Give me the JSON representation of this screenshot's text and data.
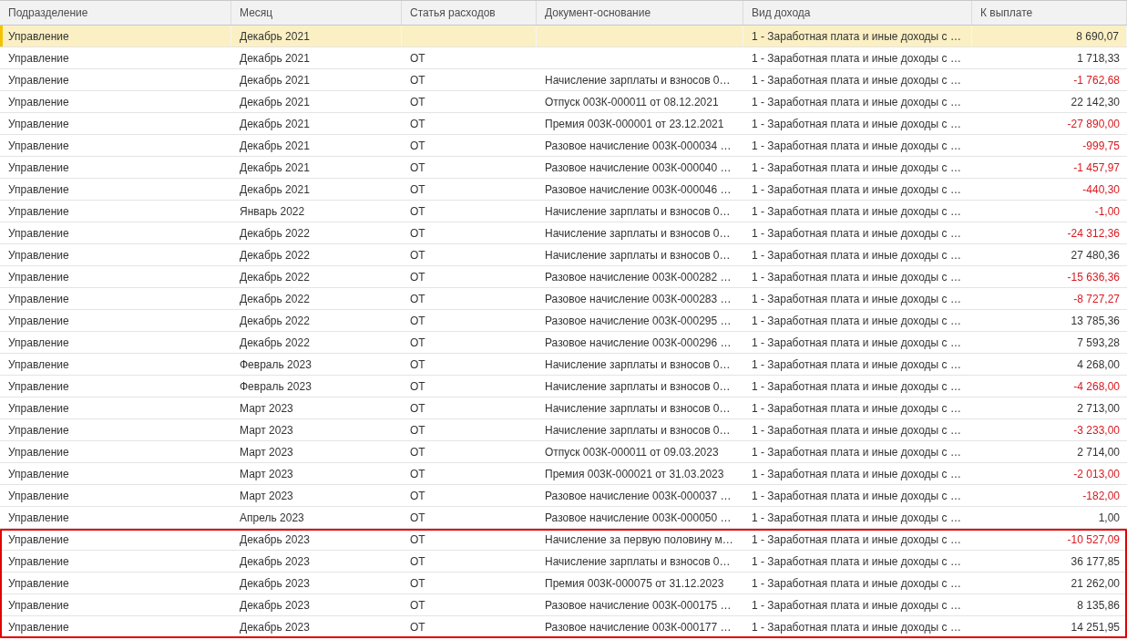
{
  "table": {
    "columns": [
      "Подразделение",
      "Месяц",
      "Статья расходов",
      "Документ-основание",
      "Вид дохода",
      "К выплате"
    ],
    "rows": [
      {
        "cells": [
          "Управление",
          "Декабрь 2021",
          "",
          "",
          "1 - Заработная плата и иные доходы с …",
          "8 690,07"
        ],
        "negative": false,
        "selected": true,
        "outlined": false
      },
      {
        "cells": [
          "Управление",
          "Декабрь 2021",
          "ОТ",
          "",
          "1 - Заработная плата и иные доходы с …",
          "1 718,33"
        ],
        "negative": false,
        "selected": false,
        "outlined": false
      },
      {
        "cells": [
          "Управление",
          "Декабрь 2021",
          "ОТ",
          "Начисление зарплаты и взносов 0…",
          "1 - Заработная плата и иные доходы с …",
          "-1 762,68"
        ],
        "negative": true,
        "selected": false,
        "outlined": false
      },
      {
        "cells": [
          "Управление",
          "Декабрь 2021",
          "ОТ",
          "Отпуск 003К-000011 от 08.12.2021",
          "1 - Заработная плата и иные доходы с …",
          "22 142,30"
        ],
        "negative": false,
        "selected": false,
        "outlined": false
      },
      {
        "cells": [
          "Управление",
          "Декабрь 2021",
          "ОТ",
          "Премия 003К-000001 от 23.12.2021",
          "1 - Заработная плата и иные доходы с …",
          "-27 890,00"
        ],
        "negative": true,
        "selected": false,
        "outlined": false
      },
      {
        "cells": [
          "Управление",
          "Декабрь 2021",
          "ОТ",
          "Разовое начисление 003К-000034 …",
          "1 - Заработная плата и иные доходы с …",
          "-999,75"
        ],
        "negative": true,
        "selected": false,
        "outlined": false
      },
      {
        "cells": [
          "Управление",
          "Декабрь 2021",
          "ОТ",
          "Разовое начисление 003К-000040 …",
          "1 - Заработная плата и иные доходы с …",
          "-1 457,97"
        ],
        "negative": true,
        "selected": false,
        "outlined": false
      },
      {
        "cells": [
          "Управление",
          "Декабрь 2021",
          "ОТ",
          "Разовое начисление 003К-000046 …",
          "1 - Заработная плата и иные доходы с …",
          "-440,30"
        ],
        "negative": true,
        "selected": false,
        "outlined": false
      },
      {
        "cells": [
          "Управление",
          "Январь 2022",
          "ОТ",
          "Начисление зарплаты и взносов 0…",
          "1 - Заработная плата и иные доходы с …",
          "-1,00"
        ],
        "negative": true,
        "selected": false,
        "outlined": false
      },
      {
        "cells": [
          "Управление",
          "Декабрь 2022",
          "ОТ",
          "Начисление зарплаты и взносов 0…",
          "1 - Заработная плата и иные доходы с …",
          "-24 312,36"
        ],
        "negative": true,
        "selected": false,
        "outlined": false
      },
      {
        "cells": [
          "Управление",
          "Декабрь 2022",
          "ОТ",
          "Начисление зарплаты и взносов 0…",
          "1 - Заработная плата и иные доходы с …",
          "27 480,36"
        ],
        "negative": false,
        "selected": false,
        "outlined": false
      },
      {
        "cells": [
          "Управление",
          "Декабрь 2022",
          "ОТ",
          "Разовое начисление 003К-000282 …",
          "1 - Заработная плата и иные доходы с …",
          "-15 636,36"
        ],
        "negative": true,
        "selected": false,
        "outlined": false
      },
      {
        "cells": [
          "Управление",
          "Декабрь 2022",
          "ОТ",
          "Разовое начисление 003К-000283 …",
          "1 - Заработная плата и иные доходы с …",
          "-8 727,27"
        ],
        "negative": true,
        "selected": false,
        "outlined": false
      },
      {
        "cells": [
          "Управление",
          "Декабрь 2022",
          "ОТ",
          "Разовое начисление 003К-000295 …",
          "1 - Заработная плата и иные доходы с …",
          "13 785,36"
        ],
        "negative": false,
        "selected": false,
        "outlined": false
      },
      {
        "cells": [
          "Управление",
          "Декабрь 2022",
          "ОТ",
          "Разовое начисление 003К-000296 …",
          "1 - Заработная плата и иные доходы с …",
          "7 593,28"
        ],
        "negative": false,
        "selected": false,
        "outlined": false
      },
      {
        "cells": [
          "Управление",
          "Февраль 2023",
          "ОТ",
          "Начисление зарплаты и взносов 0…",
          "1 - Заработная плата и иные доходы с …",
          "4 268,00"
        ],
        "negative": false,
        "selected": false,
        "outlined": false
      },
      {
        "cells": [
          "Управление",
          "Февраль 2023",
          "ОТ",
          "Начисление зарплаты и взносов 0…",
          "1 - Заработная плата и иные доходы с …",
          "-4 268,00"
        ],
        "negative": true,
        "selected": false,
        "outlined": false
      },
      {
        "cells": [
          "Управление",
          "Март 2023",
          "ОТ",
          "Начисление зарплаты и взносов 0…",
          "1 - Заработная плата и иные доходы с …",
          "2 713,00"
        ],
        "negative": false,
        "selected": false,
        "outlined": false
      },
      {
        "cells": [
          "Управление",
          "Март 2023",
          "ОТ",
          "Начисление зарплаты и взносов 0…",
          "1 - Заработная плата и иные доходы с …",
          "-3 233,00"
        ],
        "negative": true,
        "selected": false,
        "outlined": false
      },
      {
        "cells": [
          "Управление",
          "Март 2023",
          "ОТ",
          "Отпуск 003К-000011 от 09.03.2023",
          "1 - Заработная плата и иные доходы с …",
          "2 714,00"
        ],
        "negative": false,
        "selected": false,
        "outlined": false
      },
      {
        "cells": [
          "Управление",
          "Март 2023",
          "ОТ",
          "Премия 003К-000021 от 31.03.2023",
          "1 - Заработная плата и иные доходы с …",
          "-2 013,00"
        ],
        "negative": true,
        "selected": false,
        "outlined": false
      },
      {
        "cells": [
          "Управление",
          "Март 2023",
          "ОТ",
          "Разовое начисление 003К-000037 …",
          "1 - Заработная плата и иные доходы с …",
          "-182,00"
        ],
        "negative": true,
        "selected": false,
        "outlined": false
      },
      {
        "cells": [
          "Управление",
          "Апрель 2023",
          "ОТ",
          "Разовое начисление 003К-000050 …",
          "1 - Заработная плата и иные доходы с …",
          "1,00"
        ],
        "negative": false,
        "selected": false,
        "outlined": false
      },
      {
        "cells": [
          "Управление",
          "Декабрь 2023",
          "ОТ",
          "Начисление за первую половину м…",
          "1 - Заработная плата и иные доходы с …",
          "-10 527,09"
        ],
        "negative": true,
        "selected": false,
        "outlined": true
      },
      {
        "cells": [
          "Управление",
          "Декабрь 2023",
          "ОТ",
          "Начисление зарплаты и взносов 0…",
          "1 - Заработная плата и иные доходы с …",
          "36 177,85"
        ],
        "negative": false,
        "selected": false,
        "outlined": true
      },
      {
        "cells": [
          "Управление",
          "Декабрь 2023",
          "ОТ",
          "Премия 003К-000075 от 31.12.2023",
          "1 - Заработная плата и иные доходы с …",
          "21 262,00"
        ],
        "negative": false,
        "selected": false,
        "outlined": true
      },
      {
        "cells": [
          "Управление",
          "Декабрь 2023",
          "ОТ",
          "Разовое начисление 003К-000175 …",
          "1 - Заработная плата и иные доходы с …",
          "8 135,86"
        ],
        "negative": false,
        "selected": false,
        "outlined": true
      },
      {
        "cells": [
          "Управление",
          "Декабрь 2023",
          "ОТ",
          "Разовое начисление 003К-000177 …",
          "1 - Заработная плата и иные доходы с …",
          "14 251,95"
        ],
        "negative": false,
        "selected": false,
        "outlined": true
      }
    ]
  }
}
